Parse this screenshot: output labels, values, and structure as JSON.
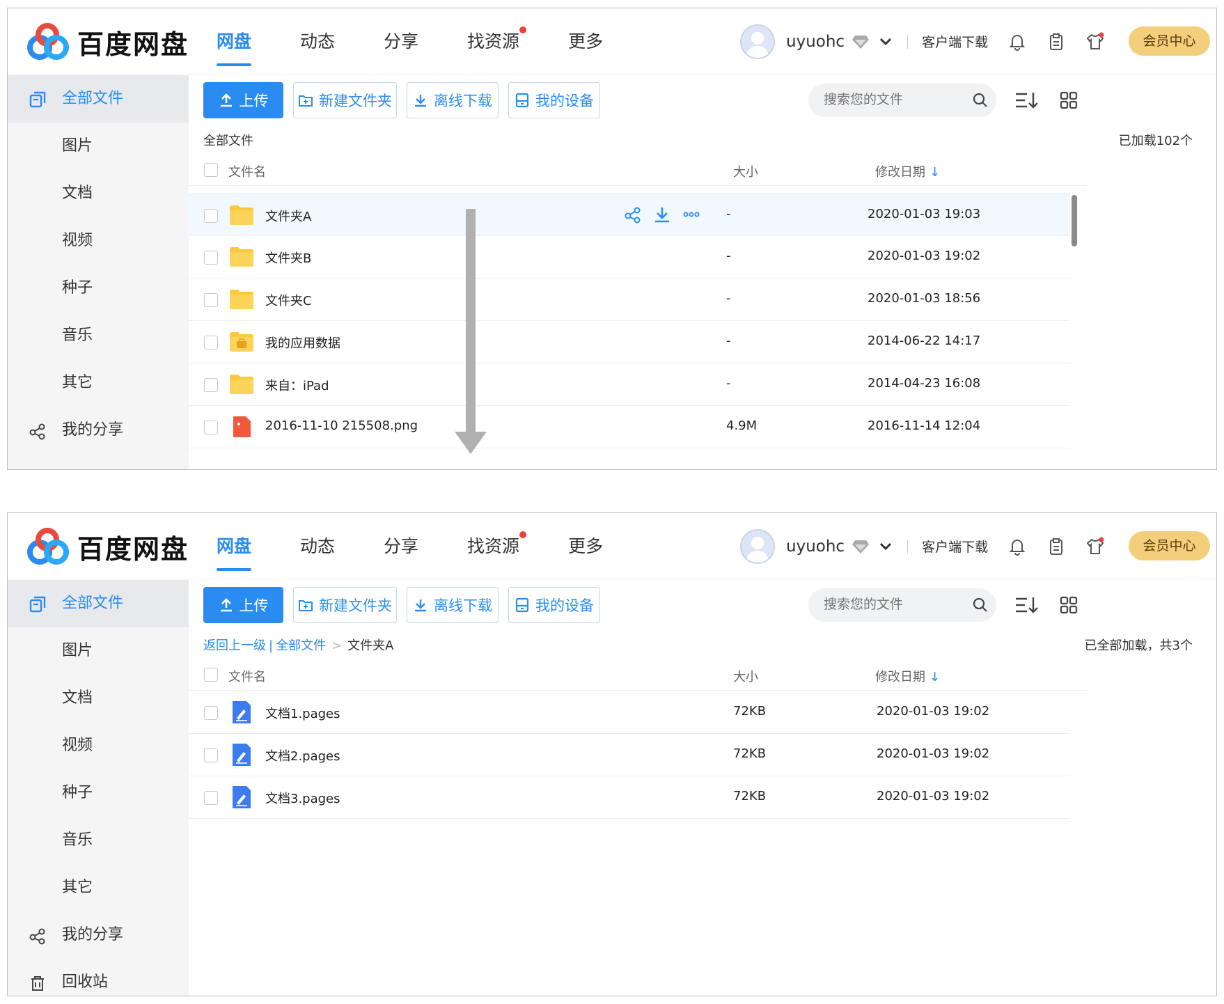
{
  "header": {
    "logo_text": "百度网盘",
    "nav": [
      {
        "label": "网盘",
        "active": true
      },
      {
        "label": "动态"
      },
      {
        "label": "分享"
      },
      {
        "label": "找资源",
        "dot": true
      },
      {
        "label": "更多"
      }
    ],
    "username": "uyuohc",
    "client_download": "客户端下载",
    "vip_center": "会员中心"
  },
  "sidebar": {
    "items": [
      {
        "label": "全部文件",
        "icon": "all-files-icon"
      },
      {
        "label": "图片"
      },
      {
        "label": "文档"
      },
      {
        "label": "视频"
      },
      {
        "label": "种子"
      },
      {
        "label": "音乐"
      },
      {
        "label": "其它"
      },
      {
        "label": "我的分享",
        "icon": "share-icon"
      },
      {
        "label": "回收站",
        "icon": "trash-icon"
      }
    ]
  },
  "toolbar": {
    "upload": "上传",
    "new_folder": "新建文件夹",
    "offline_download": "离线下载",
    "my_devices": "我的设备",
    "search_placeholder": "搜索您的文件"
  },
  "columns": {
    "name": "文件名",
    "size": "大小",
    "date": "修改日期"
  },
  "top_screen": {
    "breadcrumb": "全部文件",
    "loaded_count": "已加载102个",
    "rows": [
      {
        "name": "文件夹A",
        "size": "-",
        "date": "2020-01-03 19:03",
        "type": "folder"
      },
      {
        "name": "文件夹B",
        "size": "-",
        "date": "2020-01-03 19:02",
        "type": "folder"
      },
      {
        "name": "文件夹C",
        "size": "-",
        "date": "2020-01-03 18:56",
        "type": "folder"
      },
      {
        "name": "我的应用数据",
        "size": "-",
        "date": "2014-06-22 14:17",
        "type": "app-folder"
      },
      {
        "name": "来自：iPad",
        "size": "-",
        "date": "2014-04-23 16:08",
        "type": "folder"
      },
      {
        "name": "2016-11-10 215508.png",
        "size": "4.9M",
        "date": "2016-11-14 12:04",
        "type": "image"
      }
    ]
  },
  "bottom_screen": {
    "breadcrumb": {
      "back": "返回上一级",
      "sep": "|",
      "root": "全部文件",
      "arrow": ">",
      "current": "文件夹A"
    },
    "loaded_count": "已全部加载，共3个",
    "rows": [
      {
        "name": "文档1.pages",
        "size": "72KB",
        "date": "2020-01-03 19:02",
        "type": "pages"
      },
      {
        "name": "文档2.pages",
        "size": "72KB",
        "date": "2020-01-03 19:02",
        "type": "pages"
      },
      {
        "name": "文档3.pages",
        "size": "72KB",
        "date": "2020-01-03 19:02",
        "type": "pages"
      }
    ]
  },
  "colors": {
    "accent": "#2a8cf0",
    "folder": "#fcc83c",
    "vip": "#f3cf7c",
    "dot": "#f0413d"
  }
}
